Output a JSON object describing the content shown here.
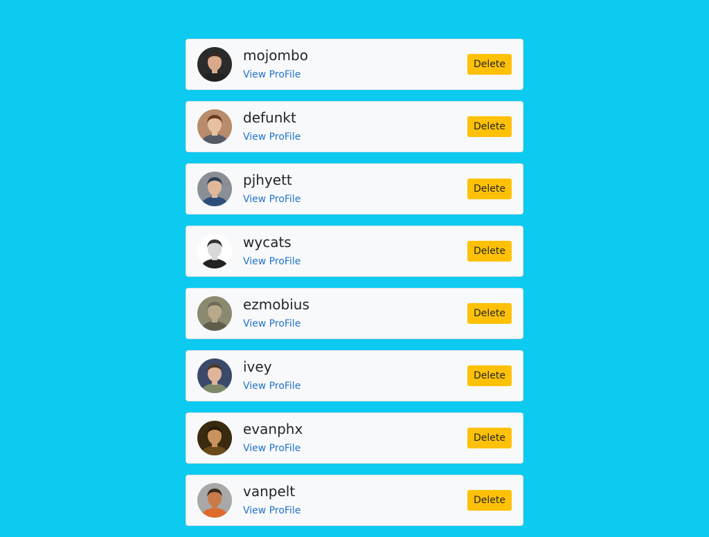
{
  "users": [
    {
      "username": "mojombo",
      "link_label": "View ProFile",
      "delete_label": "Delete",
      "avatar": {
        "bg": "#2b2b2b",
        "skin": "#d9a98a",
        "hair": "#3a2a20",
        "shirt": "#222222"
      }
    },
    {
      "username": "defunkt",
      "link_label": "View ProFile",
      "delete_label": "Delete",
      "avatar": {
        "bg": "#b78b6b",
        "skin": "#e6c1a0",
        "hair": "#6b3a1f",
        "shirt": "#555a66"
      }
    },
    {
      "username": "pjhyett",
      "link_label": "View ProFile",
      "delete_label": "Delete",
      "avatar": {
        "bg": "#8a8f96",
        "skin": "#e2b89a",
        "hair": "#2e3e55",
        "shirt": "#2f4d7a"
      }
    },
    {
      "username": "wycats",
      "link_label": "View ProFile",
      "delete_label": "Delete",
      "avatar": {
        "bg": "#ffffff",
        "skin": "#d8d8d8",
        "hair": "#333333",
        "shirt": "#222222"
      }
    },
    {
      "username": "ezmobius",
      "link_label": "View ProFile",
      "delete_label": "Delete",
      "avatar": {
        "bg": "#8b8a70",
        "skin": "#b8a98a",
        "hair": "#6e6a58",
        "shirt": "#5f5e4c"
      }
    },
    {
      "username": "ivey",
      "link_label": "View ProFile",
      "delete_label": "Delete",
      "avatar": {
        "bg": "#3b4a6b",
        "skin": "#e0b59a",
        "hair": "#4a3a2a",
        "shirt": "#7d8a6a"
      }
    },
    {
      "username": "evanphx",
      "link_label": "View ProFile",
      "delete_label": "Delete",
      "avatar": {
        "bg": "#3a2a10",
        "skin": "#c9925f",
        "hair": "#2a1a08",
        "shirt": "#6b4a1a"
      }
    },
    {
      "username": "vanpelt",
      "link_label": "View ProFile",
      "delete_label": "Delete",
      "avatar": {
        "bg": "#a8a8a8",
        "skin": "#c97a4a",
        "hair": "#3a2a1a",
        "shirt": "#e06a2a"
      }
    }
  ]
}
